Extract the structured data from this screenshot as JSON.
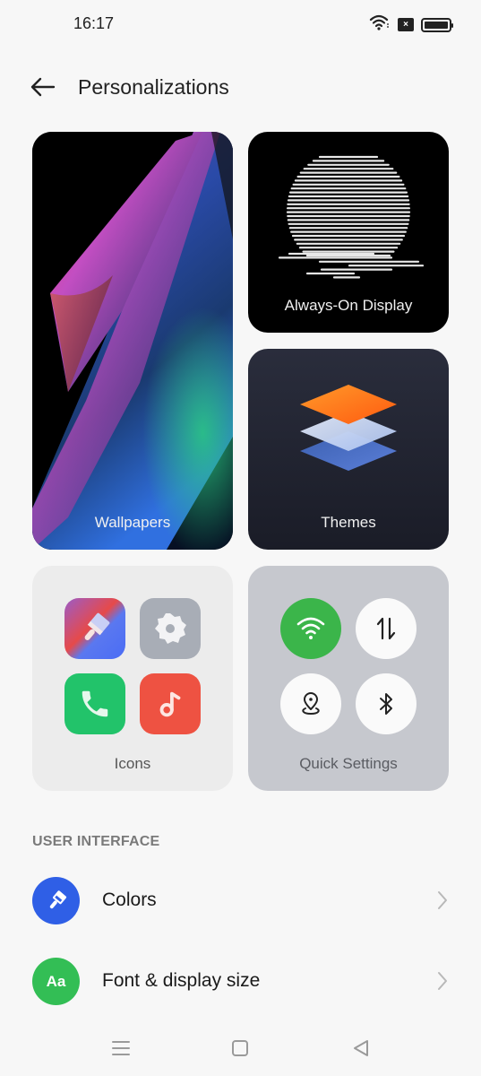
{
  "status_bar": {
    "time": "16:17",
    "icons": [
      "wifi-icon",
      "sim-absent-icon",
      "battery-icon"
    ],
    "sim_glyph": "×",
    "battery_level": 1.0
  },
  "header": {
    "back_icon": "arrow-left-icon",
    "title": "Personalizations"
  },
  "cards": {
    "wallpapers": {
      "label": "Wallpapers"
    },
    "always_on_display": {
      "label": "Always-On Display"
    },
    "themes": {
      "label": "Themes"
    },
    "icons": {
      "label": "Icons",
      "preview_icons": [
        "paintbrush-icon",
        "gear-icon",
        "phone-icon",
        "music-note-icon"
      ]
    },
    "quick_settings": {
      "label": "Quick Settings",
      "toggles": [
        {
          "icon": "wifi-icon",
          "active": true
        },
        {
          "icon": "mobile-data-icon",
          "active": false
        },
        {
          "icon": "location-icon",
          "active": false
        },
        {
          "icon": "bluetooth-icon",
          "active": false
        }
      ]
    }
  },
  "section": {
    "title": "USER INTERFACE",
    "items": [
      {
        "label": "Colors",
        "icon": "paintbrush-icon",
        "color": "#2f5fe6"
      },
      {
        "label": "Font & display size",
        "icon": "font-icon",
        "icon_text": "Aa",
        "color": "#33be55"
      }
    ]
  },
  "nav_bar": {
    "buttons": [
      "menu-icon",
      "home-icon",
      "back-icon"
    ]
  },
  "colors": {
    "background": "#f7f7f7",
    "wifi_active": "#3bb54a",
    "colors_icon": "#2f5fe6",
    "font_icon": "#33be55"
  }
}
